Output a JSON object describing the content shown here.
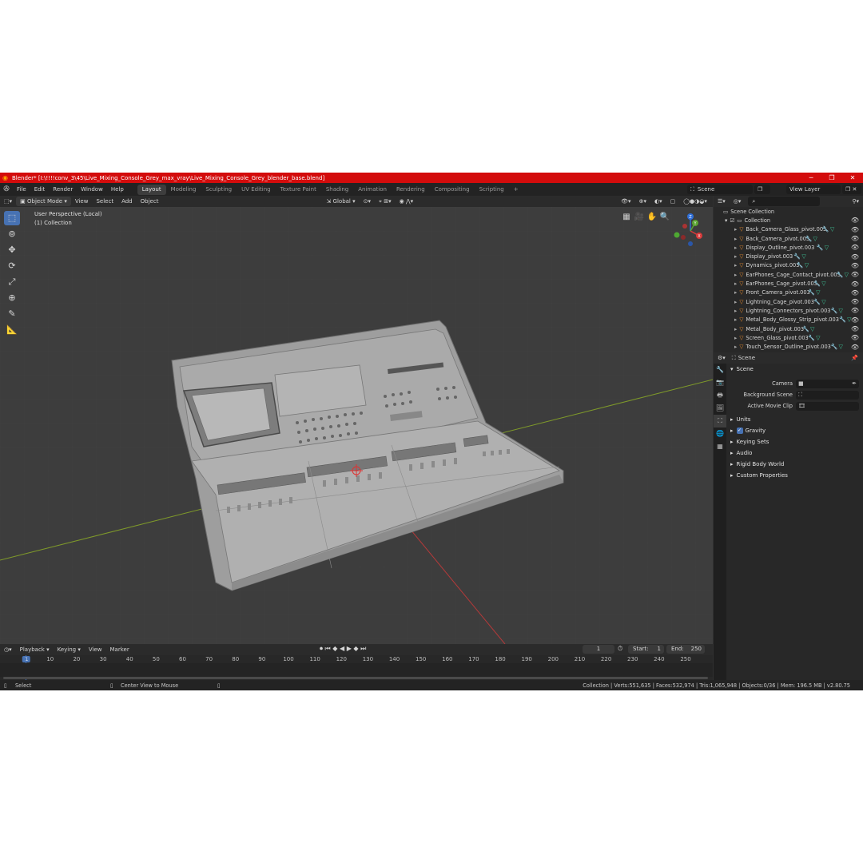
{
  "window": {
    "title": "Blender* [I:\\!!!!conv_3\\45\\Live_Mixing_Console_Grey_max_vray\\Live_Mixing_Console_Grey_blender_base.blend]",
    "minimize": "─",
    "maximize": "❐",
    "close": "✕"
  },
  "menubar": {
    "menus": [
      "File",
      "Edit",
      "Render",
      "Window",
      "Help"
    ],
    "workspaces": [
      "Layout",
      "Modeling",
      "Sculpting",
      "UV Editing",
      "Texture Paint",
      "Shading",
      "Animation",
      "Rendering",
      "Compositing",
      "Scripting"
    ],
    "active_workspace": "Layout",
    "add_tab": "+",
    "scene": "Scene",
    "view_layer": "View Layer"
  },
  "viewport_header": {
    "mode": "Object Mode",
    "menus": [
      "View",
      "Select",
      "Add",
      "Object"
    ],
    "transform_orientation": "Global"
  },
  "viewport": {
    "perspective_label": "User Perspective (Local)",
    "collection_label": "(1) Collection",
    "gizmo": {
      "z": "Z",
      "x": "X",
      "y": "Y"
    },
    "model_color": "#a8a8a8",
    "grid_axis_x_color": "#b33a3a",
    "grid_axis_y_color": "#7f9a2a"
  },
  "outliner": {
    "root": "Scene Collection",
    "collection": "Collection",
    "items": [
      "Back_Camera_Glass_pivot.003",
      "Back_Camera_pivot.003",
      "Display_Outline_pivot.003",
      "Display_pivot.003",
      "Dynamics_pivot.003",
      "EarPhones_Cage_Contact_pivot.003",
      "EarPhones_Cage_pivot.003",
      "Front_Camera_pivot.003",
      "Lightning_Cage_pivot.003",
      "Lightning_Connectors_pivot.003",
      "Metal_Body_Glossy_Strip_pivot.003",
      "Metal_Body_pivot.003",
      "Screen_Glass_pivot.003",
      "Touch_Sensor_Outline_pivot.003"
    ]
  },
  "properties": {
    "context": "Scene",
    "panel": "Scene",
    "fields": [
      {
        "label": "Camera",
        "value": ""
      },
      {
        "label": "Background Scene",
        "value": ""
      },
      {
        "label": "Active Movie Clip",
        "value": ""
      }
    ],
    "sections": [
      "Units",
      "Gravity",
      "Keying Sets",
      "Audio",
      "Rigid Body World",
      "Custom Properties"
    ],
    "gravity_checked": true
  },
  "timeline": {
    "menus": [
      "Playback",
      "Keying",
      "View",
      "Marker"
    ],
    "current_frame": "1",
    "start_label": "Start:",
    "start": "1",
    "end_label": "End:",
    "end": "250",
    "ticks": [
      "1",
      "10",
      "20",
      "30",
      "40",
      "50",
      "60",
      "70",
      "80",
      "90",
      "100",
      "110",
      "120",
      "130",
      "140",
      "150",
      "160",
      "170",
      "180",
      "190",
      "200",
      "210",
      "220",
      "230",
      "240",
      "250"
    ]
  },
  "statusbar": {
    "left": "Select",
    "middle": "Center View to Mouse",
    "right": "Collection | Verts:551,635 | Faces:532,974 | Tris:1,065,948 | Objects:0/36 | Mem: 196.5 MB | v2.80.75"
  }
}
